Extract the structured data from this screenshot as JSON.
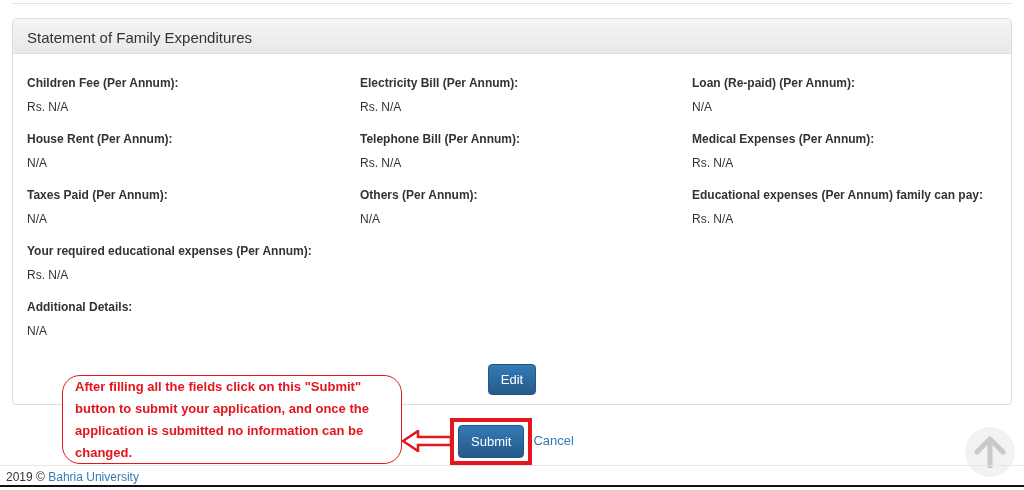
{
  "panel": {
    "title": "Statement of Family Expenditures",
    "field_rows": [
      [
        {
          "label": "Children Fee (Per Annum):",
          "value": "Rs. N/A"
        },
        {
          "label": "Electricity Bill (Per Annum):",
          "value": "Rs. N/A"
        },
        {
          "label": "Loan (Re-paid) (Per Annum):",
          "value": "N/A"
        },
        {
          "label": "House Rent (Per Annum):",
          "value": "N/A"
        },
        {
          "label": "Telephone Bill (Per Annum):",
          "value": "Rs. N/A"
        },
        {
          "label": "Medical Expenses (Per Annum):",
          "value": "Rs. N/A"
        },
        {
          "label": "Taxes Paid (Per Annum):",
          "value": "N/A"
        },
        {
          "label": "Others (Per Annum):",
          "value": "N/A"
        },
        {
          "label": "Educational expenses (Per Annum) family can pay:",
          "value": "Rs. N/A"
        }
      ],
      [
        {
          "label": "Your required educational expenses (Per Annum):",
          "value": "Rs. N/A"
        }
      ],
      [
        {
          "label": "Additional Details:",
          "value": "N/A"
        }
      ]
    ],
    "edit_button": "Edit"
  },
  "actions": {
    "submit": "Submit",
    "cancel": "Cancel"
  },
  "annotation": {
    "text": "After filling all the fields click on this \"Submit\" button to submit your application, and once the application is submitted no information can be changed."
  },
  "footer": {
    "text": "2019 ©",
    "link": "Bahria University"
  }
}
